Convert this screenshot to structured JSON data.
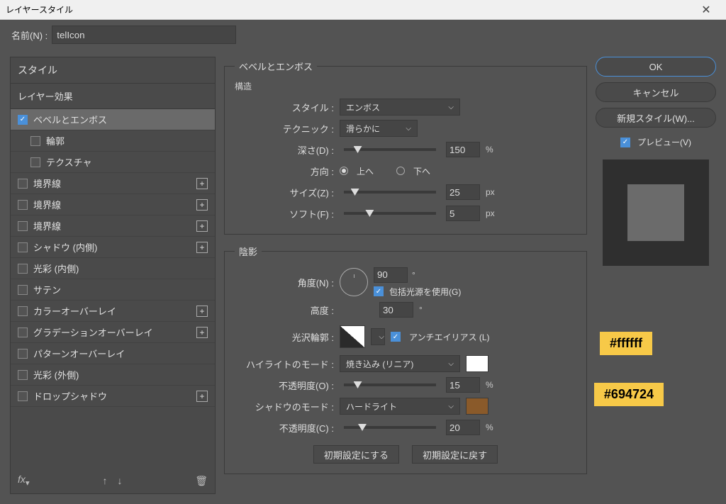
{
  "window": {
    "title": "レイヤースタイル"
  },
  "nameField": {
    "label": "名前(N) :",
    "value": "telIcon"
  },
  "stylesList": {
    "header": "スタイル",
    "layerEffects": "レイヤー効果",
    "items": [
      {
        "label": "ベベルとエンボス",
        "checked": true,
        "selected": true,
        "plus": false
      },
      {
        "label": "輪郭",
        "checked": false,
        "sub": true,
        "plus": false
      },
      {
        "label": "テクスチャ",
        "checked": false,
        "sub": true,
        "plus": false
      },
      {
        "label": "境界線",
        "checked": false,
        "plus": true
      },
      {
        "label": "境界線",
        "checked": false,
        "plus": true
      },
      {
        "label": "境界線",
        "checked": false,
        "plus": true
      },
      {
        "label": "シャドウ (内側)",
        "checked": false,
        "plus": true
      },
      {
        "label": "光彩 (内側)",
        "checked": false,
        "plus": false
      },
      {
        "label": "サテン",
        "checked": false,
        "plus": false
      },
      {
        "label": "カラーオーバーレイ",
        "checked": false,
        "plus": true
      },
      {
        "label": "グラデーションオーバーレイ",
        "checked": false,
        "plus": true
      },
      {
        "label": "パターンオーバーレイ",
        "checked": false,
        "plus": false
      },
      {
        "label": "光彩 (外側)",
        "checked": false,
        "plus": false
      },
      {
        "label": "ドロップシャドウ",
        "checked": false,
        "plus": true
      }
    ],
    "footer": {
      "fx": "fx"
    }
  },
  "panel": {
    "title": "ベベルとエンボス",
    "structure": {
      "legend": "構造",
      "styleLabel": "スタイル :",
      "styleValue": "エンボス",
      "techniqueLabel": "テクニック :",
      "techniqueValue": "滑らかに",
      "depthLabel": "深さ(D) :",
      "depthValue": "150",
      "depthUnit": "%",
      "directionLabel": "方向 :",
      "upLabel": "上へ",
      "downLabel": "下へ",
      "directionUp": true,
      "sizeLabel": "サイズ(Z) :",
      "sizeValue": "25",
      "sizeUnit": "px",
      "softLabel": "ソフト(F) :",
      "softValue": "5",
      "softUnit": "px"
    },
    "shading": {
      "legend": "陰影",
      "angleLabel": "角度(N) :",
      "angleValue": "90",
      "angleUnit": "°",
      "globalLight": "包括光源を使用(G)",
      "globalLightChecked": true,
      "altitudeLabel": "高度 :",
      "altitudeValue": "30",
      "altitudeUnit": "°",
      "glossLabel": "光沢輪郭 :",
      "antialias": "アンチエイリアス (L)",
      "antialiasChecked": true,
      "highlightModeLabel": "ハイライトのモード :",
      "highlightModeValue": "焼き込み (リニア)",
      "highlightColor": "#ffffff",
      "highlightOpacityLabel": "不透明度(O) :",
      "highlightOpacityValue": "15",
      "highlightOpacityUnit": "%",
      "shadowModeLabel": "シャドウのモード :",
      "shadowModeValue": "ハードライト",
      "shadowColor": "#8a5a2a",
      "shadowOpacityLabel": "不透明度(C) :",
      "shadowOpacityValue": "20",
      "shadowOpacityUnit": "%"
    },
    "defaultBtn": "初期設定にする",
    "resetBtn": "初期設定に戻す"
  },
  "rightButtons": {
    "ok": "OK",
    "cancel": "キャンセル",
    "newStyle": "新規スタイル(W)...",
    "preview": "プレビュー(V)"
  },
  "callouts": {
    "highlight": "#ffffff",
    "shadow": "#694724"
  }
}
